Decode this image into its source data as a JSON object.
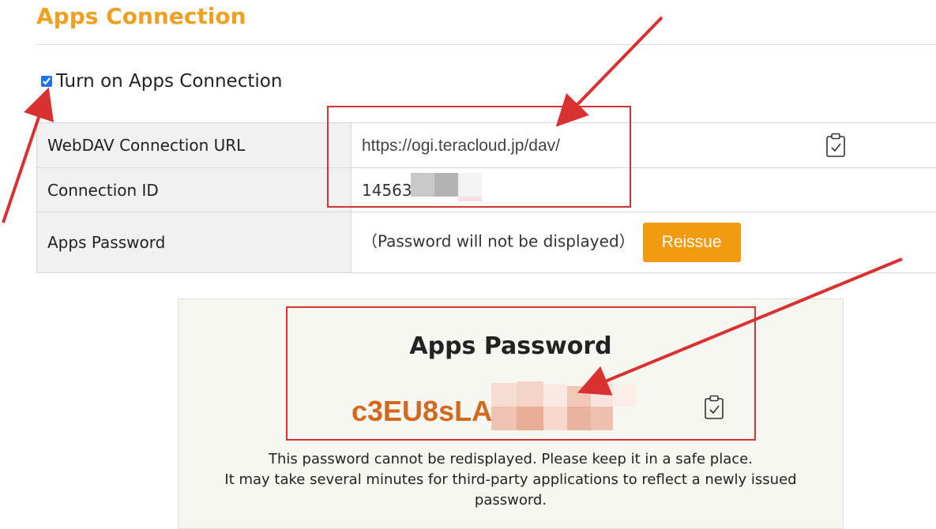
{
  "page": {
    "title": "Apps Connection",
    "toggle_label": "Turn on Apps Connection",
    "toggle_checked": true
  },
  "settings": {
    "rows": [
      {
        "label": "WebDAV Connection URL",
        "value": "https://ogi.teracloud.jp/dav/"
      },
      {
        "label": "Connection ID",
        "value": "14563"
      },
      {
        "label": "Apps Password",
        "value": "（Password will not be displayed）"
      }
    ],
    "reissue_label": "Reissue"
  },
  "panel": {
    "title": "Apps Password",
    "password": "c3EU8sLA",
    "note_line1": "This password cannot be redisplayed. Please keep it in a safe place.",
    "note_line2": "It may take several minutes for third-party applications to reflect a newly issued",
    "note_line3": "password."
  },
  "icons": {
    "copy": "clipboard-check-icon"
  },
  "colors": {
    "title": "#f0a020",
    "button": "#f29a10",
    "password": "#d2691e",
    "annotation": "#d93030"
  }
}
